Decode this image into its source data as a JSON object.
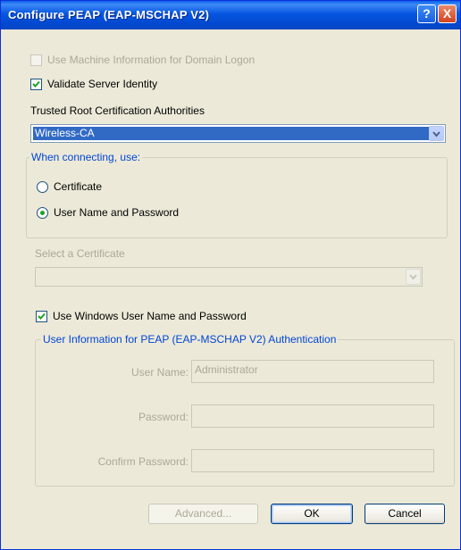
{
  "window": {
    "title": "Configure PEAP (EAP-MSCHAP V2)",
    "help_glyph": "?",
    "close_glyph": "X"
  },
  "options": {
    "machine_info": {
      "label": "Use Machine Information for Domain Logon",
      "checked": false,
      "enabled": false
    },
    "validate_server": {
      "label": "Validate Server Identity",
      "checked": true,
      "enabled": true
    }
  },
  "trusted_ca": {
    "label": "Trusted Root Certification Authorities",
    "selected": "Wireless-CA"
  },
  "connect_group": {
    "legend": "When connecting, use:",
    "certificate_label": "Certificate",
    "password_label": "User Name and Password",
    "selected": "password"
  },
  "certificate": {
    "label": "Select a Certificate",
    "selected": ""
  },
  "use_windows": {
    "label": "Use Windows User Name and Password",
    "checked": true
  },
  "user_info": {
    "legend": "User Information for PEAP (EAP-MSCHAP V2) Authentication",
    "username_label": "User Name:",
    "username_value": "Administrator",
    "password_label": "Password:",
    "password_value": "",
    "confirm_label": "Confirm Password:",
    "confirm_value": ""
  },
  "buttons": {
    "advanced": "Advanced...",
    "ok": "OK",
    "cancel": "Cancel"
  },
  "colors": {
    "titlebar": "#0556e0",
    "dialog_bg": "#ece9d8",
    "selection": "#316ac5",
    "group_legend": "#0046d5",
    "disabled_text": "#aca899"
  }
}
